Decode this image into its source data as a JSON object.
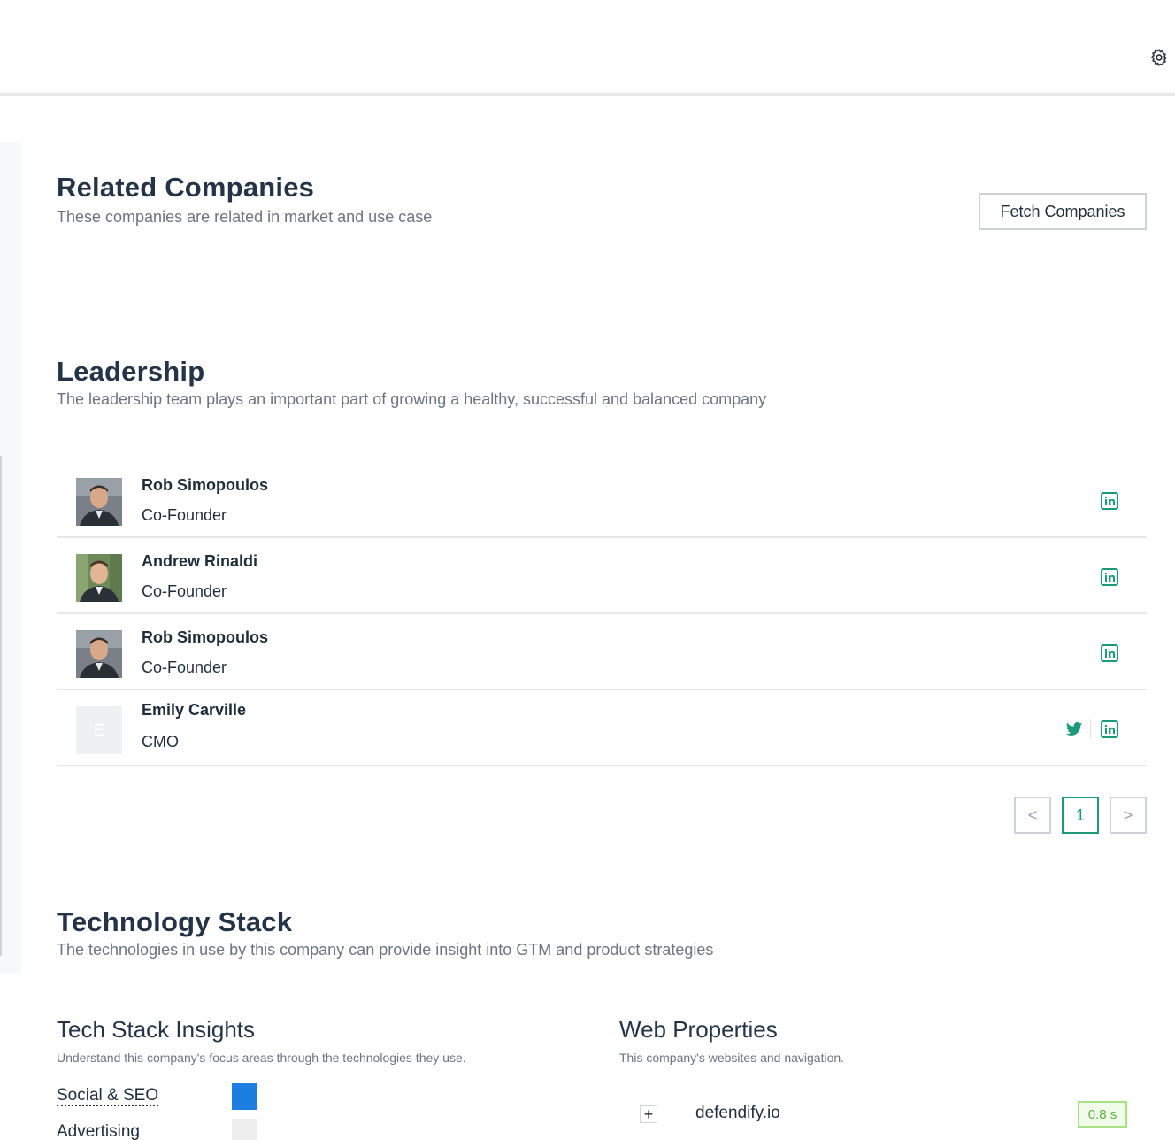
{
  "header": {
    "settings_icon": "gear-icon"
  },
  "related": {
    "title": "Related Companies",
    "subtitle": "These companies are related in market and use case",
    "fetch_button": "Fetch Companies"
  },
  "leadership": {
    "title": "Leadership",
    "subtitle": "The leadership team plays an important part of growing a healthy, successful and balanced company",
    "people": [
      {
        "name": "Rob Simopoulos",
        "role": "Co-Founder",
        "avatar": "photo",
        "social": [
          "linkedin-icon"
        ]
      },
      {
        "name": "Andrew Rinaldi",
        "role": "Co-Founder",
        "avatar": "photo",
        "social": [
          "linkedin-icon"
        ]
      },
      {
        "name": "Rob Simopoulos",
        "role": "Co-Founder",
        "avatar": "photo",
        "social": [
          "linkedin-icon"
        ]
      },
      {
        "name": "Emily Carville",
        "role": "CMO",
        "avatar": "E",
        "social": [
          "twitter-icon",
          "linkedin-icon"
        ]
      }
    ],
    "pagination": {
      "prev": "<",
      "current": "1",
      "next": ">"
    }
  },
  "tech": {
    "title": "Technology Stack",
    "subtitle": "The technologies in use by this company can provide insight into GTM and product strategies",
    "insights": {
      "title": "Tech Stack Insights",
      "description": "Understand this company's focus areas through the technologies they use.",
      "items": [
        {
          "label": "Social & SEO",
          "color": "#1a7fe0"
        },
        {
          "label": "Advertising",
          "color": "#eeeeee"
        }
      ]
    },
    "web": {
      "title": "Web Properties",
      "description": "This company's websites and navigation.",
      "rows": [
        {
          "expand": "+",
          "domain": "defendify.io",
          "speed": "0.8 s"
        }
      ]
    }
  },
  "colors": {
    "accent": "#1a9a7a",
    "heading": "#243446",
    "muted": "#6b7480"
  }
}
